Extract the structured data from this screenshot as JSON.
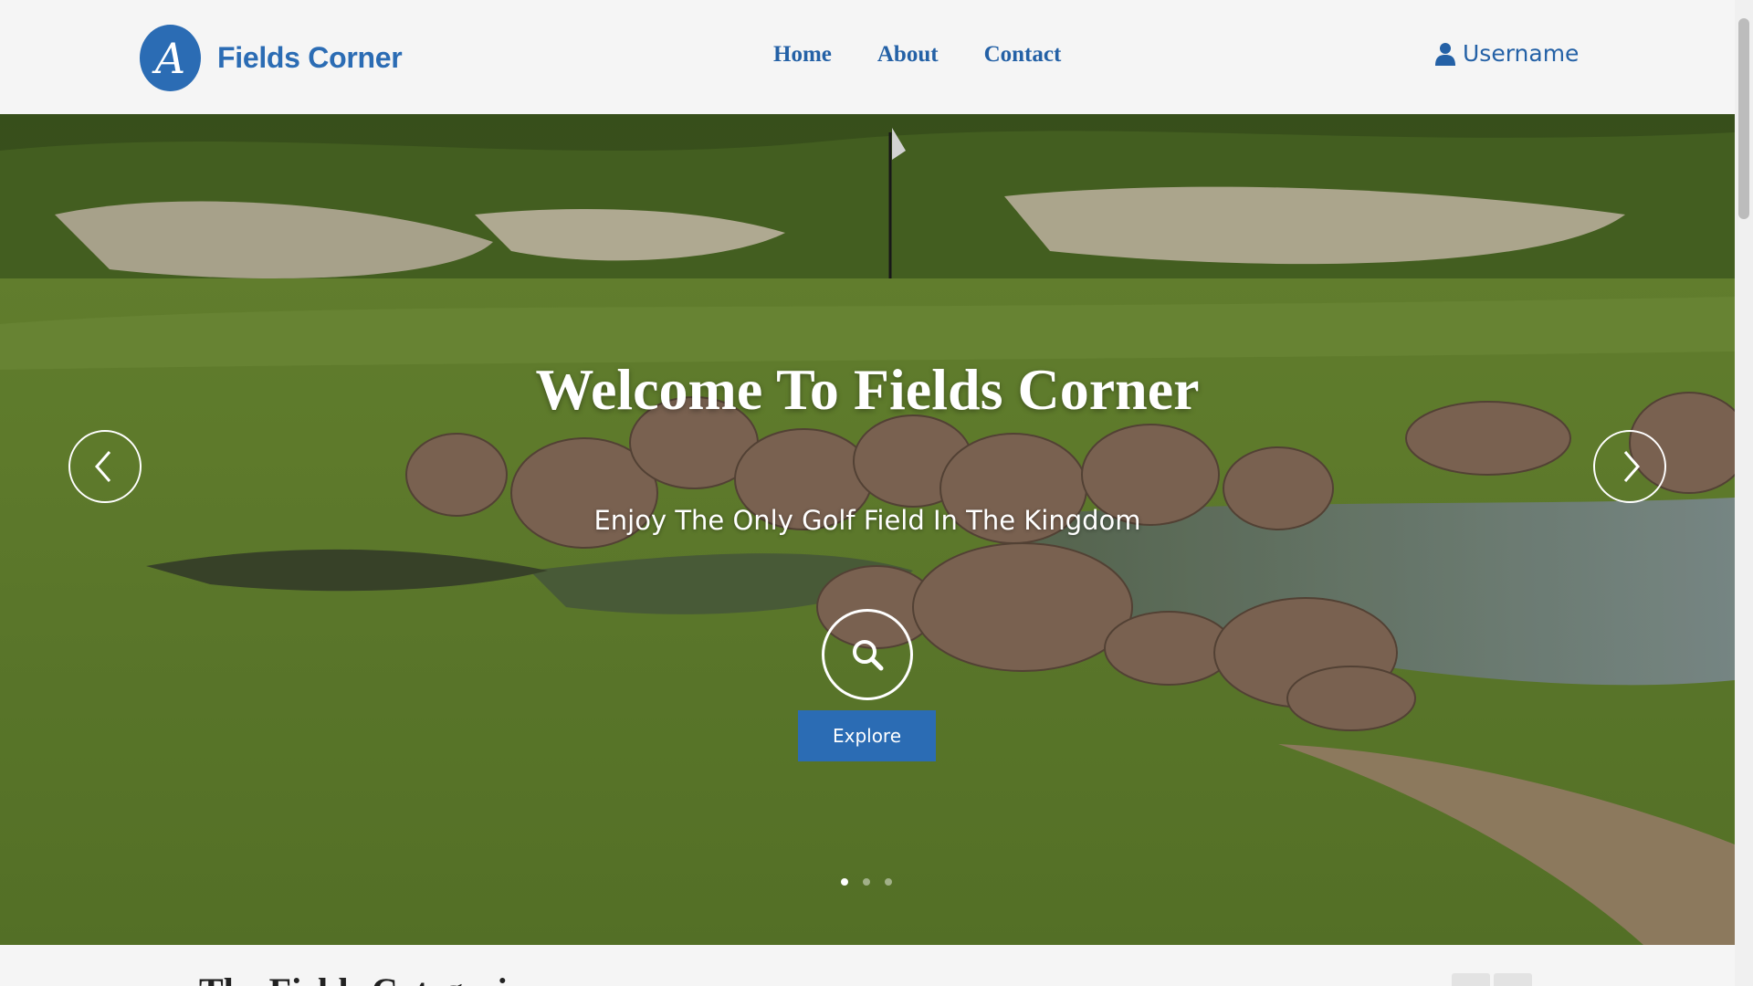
{
  "header": {
    "brand_letter": "A",
    "brand_name": "Fields Corner",
    "nav": [
      {
        "label": "Home"
      },
      {
        "label": "About"
      },
      {
        "label": "Contact"
      }
    ],
    "user": {
      "icon": "user-icon",
      "label": "Username"
    }
  },
  "hero": {
    "title": "Welcome To Fields Corner",
    "subtitle": "Enjoy The Only Golf Field In The Kingdom",
    "search_icon": "search-icon",
    "cta_label": "Explore",
    "prev_icon": "chevron-left-icon",
    "next_icon": "chevron-right-icon",
    "slides_total": 3,
    "active_slide": 1
  },
  "section": {
    "title": "The Fields Categories"
  },
  "colors": {
    "brand": "#2b6cb4",
    "nav_text": "#2461a6",
    "background": "#f5f5f5"
  }
}
